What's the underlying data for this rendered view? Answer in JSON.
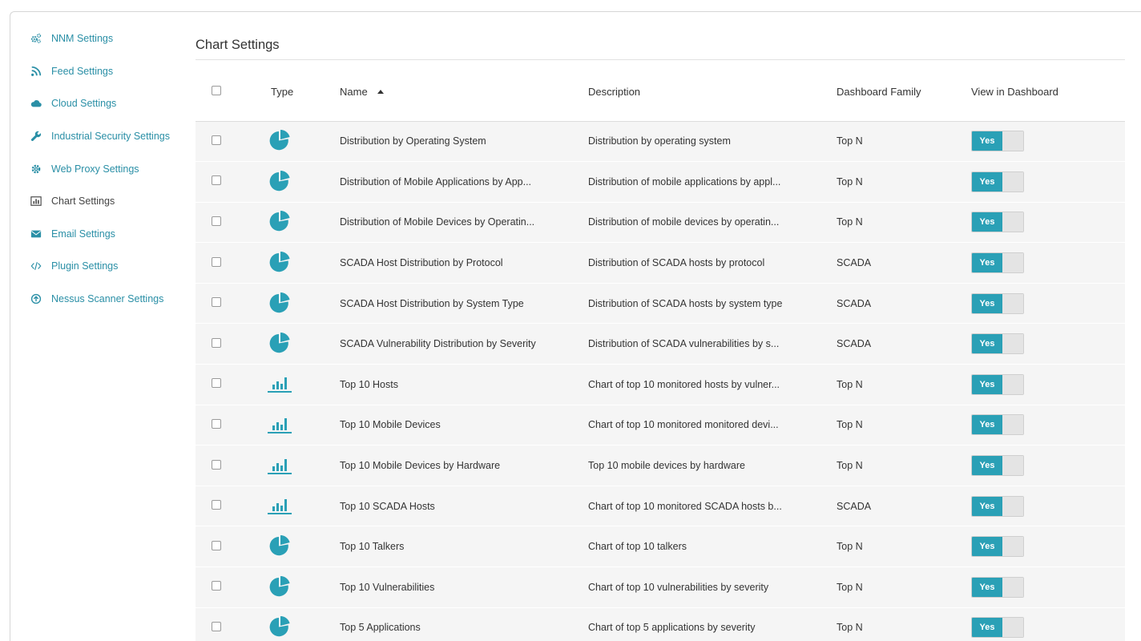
{
  "colors": {
    "accent": "#2aa0b6",
    "link": "#2a8fa6",
    "row_bg": "#f5f5f5"
  },
  "sidebar": {
    "items": [
      {
        "label": "NNM Settings",
        "icon": "cogs-icon",
        "active": false
      },
      {
        "label": "Feed Settings",
        "icon": "rss-icon",
        "active": false
      },
      {
        "label": "Cloud Settings",
        "icon": "cloud-icon",
        "active": false
      },
      {
        "label": "Industrial Security Settings",
        "icon": "wrench-icon",
        "active": false
      },
      {
        "label": "Web Proxy Settings",
        "icon": "gear-icon",
        "active": false
      },
      {
        "label": "Chart Settings",
        "icon": "bar-chart-icon",
        "active": true
      },
      {
        "label": "Email Settings",
        "icon": "envelope-icon",
        "active": false
      },
      {
        "label": "Plugin Settings",
        "icon": "code-icon",
        "active": false
      },
      {
        "label": "Nessus Scanner Settings",
        "icon": "circle-arrow-up-icon",
        "active": false
      }
    ]
  },
  "main": {
    "title": "Chart Settings",
    "columns": {
      "type": "Type",
      "name": "Name",
      "description": "Description",
      "family": "Dashboard Family",
      "view": "View in Dashboard"
    },
    "rows": [
      {
        "type": "pie",
        "name": "Distribution by Operating System",
        "description": "Distribution by operating system",
        "family": "Top N",
        "view": "Yes"
      },
      {
        "type": "pie",
        "name": "Distribution of Mobile Applications by App...",
        "description": "Distribution of mobile applications by appl...",
        "family": "Top N",
        "view": "Yes"
      },
      {
        "type": "pie",
        "name": "Distribution of Mobile Devices by Operatin...",
        "description": "Distribution of mobile devices by operatin...",
        "family": "Top N",
        "view": "Yes"
      },
      {
        "type": "pie",
        "name": "SCADA Host Distribution by Protocol",
        "description": "Distribution of SCADA hosts by protocol",
        "family": "SCADA",
        "view": "Yes"
      },
      {
        "type": "pie",
        "name": "SCADA Host Distribution by System Type",
        "description": "Distribution of SCADA hosts by system type",
        "family": "SCADA",
        "view": "Yes"
      },
      {
        "type": "pie",
        "name": "SCADA Vulnerability Distribution by Severity",
        "description": "Distribution of SCADA vulnerabilities by s...",
        "family": "SCADA",
        "view": "Yes"
      },
      {
        "type": "bar",
        "name": "Top 10 Hosts",
        "description": "Chart of top 10 monitored hosts by vulner...",
        "family": "Top N",
        "view": "Yes"
      },
      {
        "type": "bar",
        "name": "Top 10 Mobile Devices",
        "description": "Chart of top 10 monitored monitored devi...",
        "family": "Top N",
        "view": "Yes"
      },
      {
        "type": "bar",
        "name": "Top 10 Mobile Devices by Hardware",
        "description": "Top 10 mobile devices by hardware",
        "family": "Top N",
        "view": "Yes"
      },
      {
        "type": "bar",
        "name": "Top 10 SCADA Hosts",
        "description": "Chart of top 10 monitored SCADA hosts b...",
        "family": "SCADA",
        "view": "Yes"
      },
      {
        "type": "pie",
        "name": "Top 10 Talkers",
        "description": "Chart of top 10 talkers",
        "family": "Top N",
        "view": "Yes"
      },
      {
        "type": "pie",
        "name": "Top 10 Vulnerabilities",
        "description": "Chart of top 10 vulnerabilities by severity",
        "family": "Top N",
        "view": "Yes"
      },
      {
        "type": "pie",
        "name": "Top 5 Applications",
        "description": "Chart of top 5 applications by severity",
        "family": "Top N",
        "view": "Yes"
      }
    ]
  }
}
